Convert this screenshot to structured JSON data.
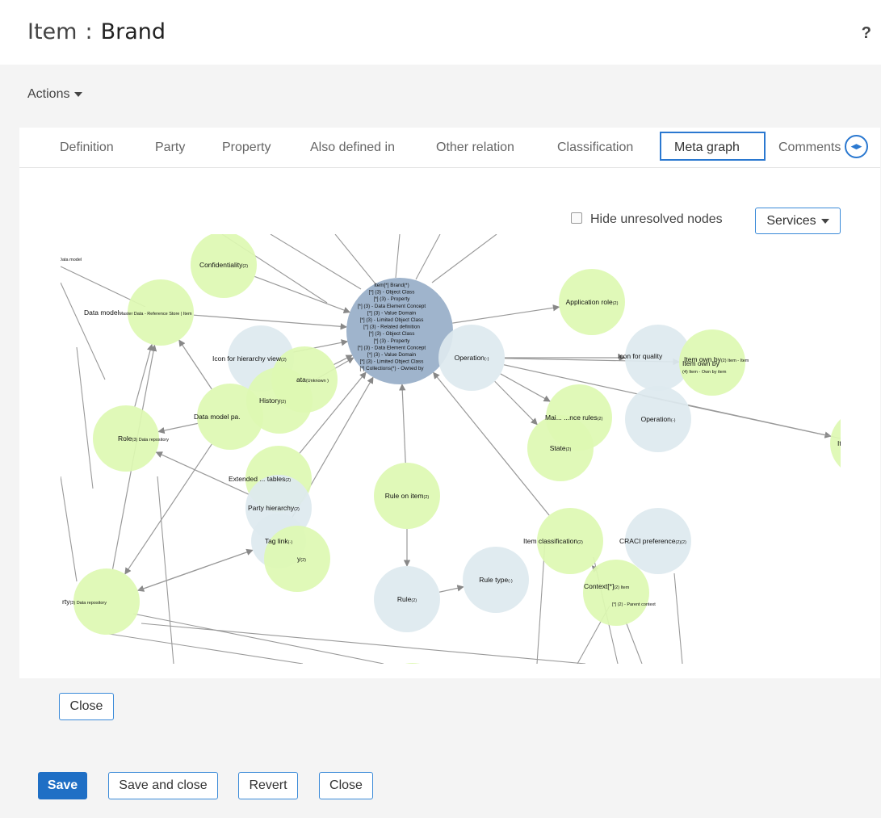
{
  "header": {
    "item_label": "Item",
    "separator": ":",
    "item_name": "Brand",
    "help": "?"
  },
  "actions": {
    "label": "Actions"
  },
  "tabs": [
    {
      "label": "Definition"
    },
    {
      "label": "Party"
    },
    {
      "label": "Property"
    },
    {
      "label": "Also defined in"
    },
    {
      "label": "Other relation"
    },
    {
      "label": "Classification"
    },
    {
      "label": "Meta graph",
      "active": true
    },
    {
      "label": "Comments"
    }
  ],
  "tab_scroll_icon": "left-right-arrows-icon",
  "graph_controls": {
    "hide_unresolved_label": "Hide unresolved nodes",
    "hide_unresolved_checked": false,
    "services_label": "Services"
  },
  "graph": {
    "colors": {
      "green": "#ddf8b2",
      "light_blue": "#dde9ef",
      "center": "#9fb4cc",
      "edge": "#999999"
    },
    "nodes": [
      {
        "id": "confidentiality",
        "label": "Confidentiality",
        "sub": "(2)",
        "style": "green"
      },
      {
        "id": "data-model",
        "label": "Data model",
        "sub": "Master Data - Reference Store | Item",
        "style": "green"
      },
      {
        "id": "icon-hierarchy",
        "label": "Icon for hierarchy view",
        "sub": "(2)",
        "style": "light_blue"
      },
      {
        "id": "ata",
        "label": "ata",
        "sub": "(Unknown )",
        "style": "green"
      },
      {
        "id": "history",
        "label": "History",
        "sub": "(2)",
        "style": "green"
      },
      {
        "id": "data-model-pa",
        "label": "Data model pa.",
        "sub": "",
        "style": "green"
      },
      {
        "id": "role",
        "label": "Role",
        "sub": "(3) Data repository",
        "style": "green"
      },
      {
        "id": "extended-tables",
        "label": "Extended ... tables",
        "sub": "(2)",
        "style": "green"
      },
      {
        "id": "party-hierarchy",
        "label": "Party hierarchy",
        "sub": "(2)",
        "style": "light_blue"
      },
      {
        "id": "tag-link",
        "label": "Tag link",
        "sub": "(-)",
        "style": "light_blue"
      },
      {
        "id": "y-node",
        "label": "y",
        "sub": "(2)",
        "style": "green"
      },
      {
        "id": "party",
        "label": "rty",
        "sub": "(3) Data repository",
        "style": "green"
      },
      {
        "id": "center",
        "label": "Item[*] Brand",
        "sub": "",
        "style": "center"
      },
      {
        "id": "rule-on-item",
        "label": "Rule on item",
        "sub": "(2)",
        "style": "green"
      },
      {
        "id": "rule",
        "label": "Rule",
        "sub": "(2)",
        "style": "light_blue"
      },
      {
        "id": "rule-type",
        "label": "Rule type",
        "sub": "(-)",
        "style": "light_blue"
      },
      {
        "id": "bottom-node",
        "label": "",
        "sub": "",
        "style": "green"
      },
      {
        "id": "operation-1",
        "label": "Operation",
        "sub": "(-)",
        "style": "light_blue"
      },
      {
        "id": "application-role",
        "label": "Application role",
        "sub": "(2)",
        "style": "green"
      },
      {
        "id": "icon-quality",
        "label": "Icon for quality",
        "sub": "",
        "style": "light_blue"
      },
      {
        "id": "item-own-by",
        "label": "Item own by",
        "sub": "(2) Item - Item",
        "style": "green"
      },
      {
        "id": "maintenance-rules",
        "label": "Mai... ...nce rules",
        "sub": "(2)",
        "style": "green"
      },
      {
        "id": "state",
        "label": "State",
        "sub": "(2)",
        "style": "green"
      },
      {
        "id": "operation-2",
        "label": "Operation",
        "sub": "(-)",
        "style": "light_blue"
      },
      {
        "id": "item-r",
        "label": "Item r",
        "sub": "",
        "style": "green"
      },
      {
        "id": "item-classification",
        "label": "Item classification",
        "sub": "(2)",
        "style": "green"
      },
      {
        "id": "craci",
        "label": "CRACI preference",
        "sub": "(2)(2)",
        "style": "light_blue"
      },
      {
        "id": "context",
        "label": "Context[*]",
        "sub": "(2) Item",
        "style": "green"
      }
    ],
    "center_lines": [
      "Item[*] Brand(*)",
      "[*] (3) - Object Class",
      "[*] (3) - Property",
      "[*] (3) - Data Element Concept",
      "[*] (3) - Value Domain",
      "[*] (3) - Limited Object Class",
      "[*] (3) - Related definition",
      "[*] (3) - Object Class",
      "[*] (3) - Property",
      "[*] (3) - Data Element Concept",
      "[*] (3) - Value Domain",
      "[*] (3) - Limited Object Class",
      "[*] Collections(*) - Owned by"
    ],
    "extra_labels": [
      "Data model",
      "Item own by",
      "(4) Item - Own by item",
      "[*] (2) - Parent context"
    ]
  },
  "panel": {
    "close_label": "Close"
  },
  "footer": {
    "save_label": "Save",
    "save_close_label": "Save and close",
    "revert_label": "Revert",
    "close_label": "Close"
  }
}
